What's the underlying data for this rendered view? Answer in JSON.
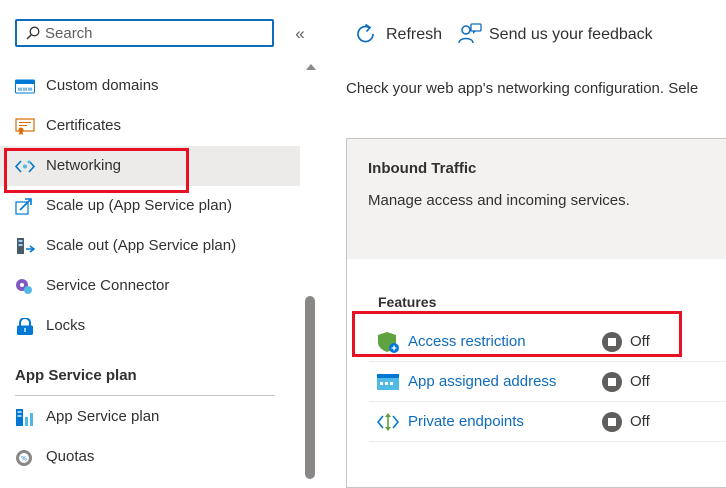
{
  "sidebar": {
    "search_placeholder": "Search",
    "collapse_glyph": "«",
    "items": [
      {
        "label": "Custom domains",
        "icon": "www-icon"
      },
      {
        "label": "Certificates",
        "icon": "certificate-icon"
      },
      {
        "label": "Networking",
        "icon": "networking-icon",
        "selected": true
      },
      {
        "label": "Scale up (App Service plan)",
        "icon": "scale-up-icon"
      },
      {
        "label": "Scale out (App Service plan)",
        "icon": "scale-out-icon"
      },
      {
        "label": "Service Connector",
        "icon": "service-connector-icon"
      },
      {
        "label": "Locks",
        "icon": "lock-icon"
      }
    ],
    "section_title": "App Service plan",
    "section_items": [
      {
        "label": "App Service plan",
        "icon": "app-service-plan-icon"
      },
      {
        "label": "Quotas",
        "icon": "quotas-icon"
      }
    ]
  },
  "toolbar": {
    "refresh_label": "Refresh",
    "feedback_label": "Send us your feedback"
  },
  "main": {
    "description": "Check your web app's networking configuration. Sele",
    "card": {
      "title": "Inbound Traffic",
      "subtitle": "Manage access and incoming services.",
      "features_label": "Features",
      "features": [
        {
          "label": "Access restriction",
          "status": "Off",
          "icon": "shield-icon"
        },
        {
          "label": "App assigned address",
          "status": "Off",
          "icon": "ip-address-icon"
        },
        {
          "label": "Private endpoints",
          "status": "Off",
          "icon": "private-endpoint-icon"
        }
      ]
    }
  },
  "colors": {
    "accent": "#0f6cbd",
    "highlight": "#e81123",
    "selected_bg": "#edebe9"
  }
}
